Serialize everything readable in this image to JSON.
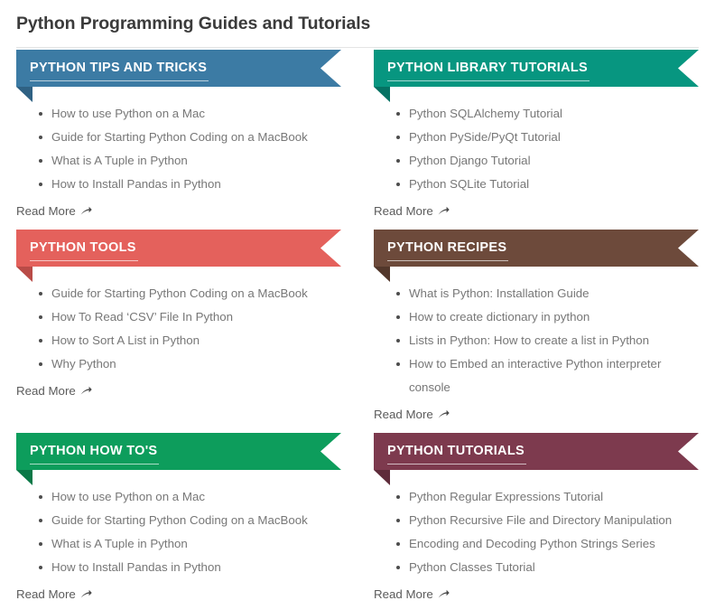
{
  "page": {
    "title": "Python Programming Guides and Tutorials"
  },
  "common": {
    "read_more_label": "Read More",
    "read_more_icon": "arrow-up-right-icon",
    "bullet_icon": "bullet-dot-icon"
  },
  "cards": [
    {
      "id": "python-tips-and-tricks",
      "title": "PYTHON TIPS AND TRICKS",
      "color": "#3c7ba4",
      "fold_color": "#2f6183",
      "items": [
        "How to use Python on a Mac",
        "Guide for Starting Python Coding on a MacBook",
        "What is A Tuple in Python",
        "How to Install Pandas in Python"
      ],
      "read_more": "Read More"
    },
    {
      "id": "python-library-tutorials",
      "title": "PYTHON LIBRARY TUTORIALS",
      "color": "#079680",
      "fold_color": "#057263",
      "items": [
        "Python SQLAlchemy Tutorial",
        "Python PySide/PyQt Tutorial",
        "Python Django Tutorial",
        "Python SQLite Tutorial"
      ],
      "read_more": "Read More"
    },
    {
      "id": "python-tools",
      "title": "PYTHON TOOLS",
      "color": "#e4615c",
      "fold_color": "#b94b47",
      "items": [
        "Guide for Starting Python Coding on a MacBook",
        "How To Read ‘CSV’ File In Python",
        "How to Sort A List in Python",
        "Why Python"
      ],
      "read_more": "Read More"
    },
    {
      "id": "python-recipes",
      "title": "PYTHON RECIPES",
      "color": "#6d4a3b",
      "fold_color": "#52372b",
      "items": [
        "What is Python: Installation Guide",
        "How to create dictionary in python",
        "Lists in Python: How to create a list in Python",
        "How to Embed an interactive Python interpreter console"
      ],
      "read_more": "Read More"
    },
    {
      "id": "python-how-tos",
      "title": "PYTHON HOW TO'S",
      "color": "#0d9d5c",
      "fold_color": "#0a7847",
      "items": [
        "How to use Python on a Mac",
        "Guide for Starting Python Coding on a MacBook",
        "What is A Tuple in Python",
        "How to Install Pandas in Python"
      ],
      "read_more": "Read More"
    },
    {
      "id": "python-tutorials",
      "title": "PYTHON TUTORIALS",
      "color": "#7d3a4e",
      "fold_color": "#5e2b3a",
      "items": [
        "Python Regular Expressions Tutorial",
        "Python Recursive File and Directory Manipulation",
        "Encoding and Decoding Python Strings Series",
        "Python Classes Tutorial"
      ],
      "read_more": "Read More"
    }
  ]
}
